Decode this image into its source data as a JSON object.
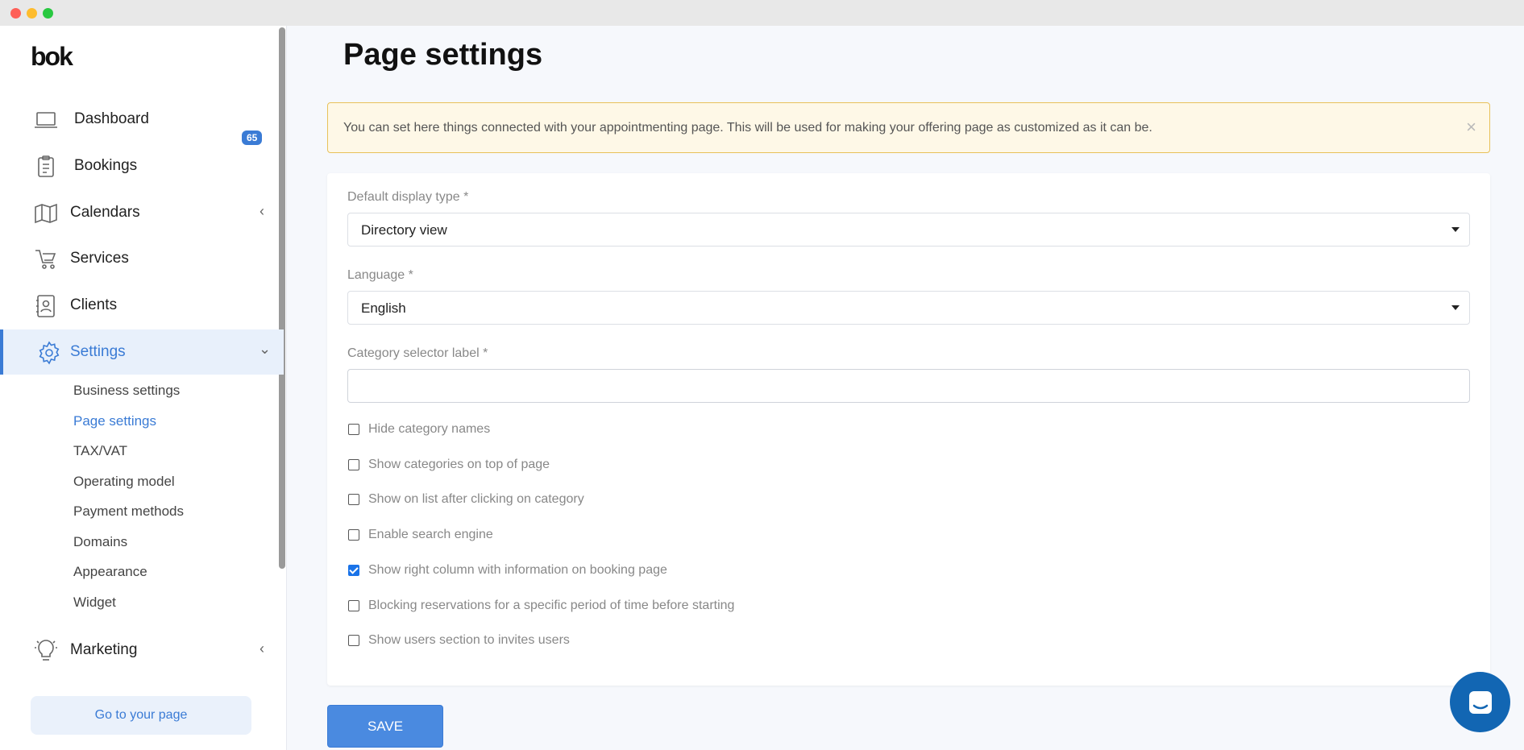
{
  "window": {
    "buttons": [
      "close",
      "minimize",
      "maximize"
    ]
  },
  "brand": {
    "logo": "bok"
  },
  "sidebar": {
    "items": [
      {
        "label": "Dashboard",
        "icon": "laptop-icon"
      },
      {
        "label": "Bookings",
        "icon": "clipboard-icon",
        "badge": "65"
      },
      {
        "label": "Calendars",
        "icon": "map-icon",
        "chevron": "‹"
      },
      {
        "label": "Services",
        "icon": "cart-icon"
      },
      {
        "label": "Clients",
        "icon": "contacts-icon"
      },
      {
        "label": "Settings",
        "icon": "gear-icon",
        "chevron": "⌄"
      },
      {
        "label": "Marketing",
        "icon": "lightbulb-icon",
        "chevron": "‹"
      }
    ],
    "settings_submenu": [
      "Business settings",
      "Page settings",
      "TAX/VAT",
      "Operating model",
      "Payment methods",
      "Domains",
      "Appearance",
      "Widget"
    ],
    "go_to_page": "Go to your page"
  },
  "main": {
    "title": "Page settings",
    "alert": {
      "text": "You can set here things connected with your appointmenting page. This will be used for making your offering page as customized as it can be.",
      "close": "×"
    },
    "form": {
      "display_type": {
        "label": "Default display type *",
        "value": "Directory view"
      },
      "language": {
        "label": "Language *",
        "value": "English"
      },
      "category_label": {
        "label": "Category selector label *",
        "value": ""
      },
      "checkboxes": [
        {
          "label": "Hide category names",
          "checked": false
        },
        {
          "label": "Show categories on top of page",
          "checked": false
        },
        {
          "label": "Show on list after clicking on category",
          "checked": false
        },
        {
          "label": "Enable search engine",
          "checked": false
        },
        {
          "label": "Show right column with information on booking page",
          "checked": true
        },
        {
          "label": "Blocking reservations for a specific period of time before starting",
          "checked": false
        },
        {
          "label": "Show users section to invites users",
          "checked": false
        }
      ]
    },
    "save_label": "SAVE"
  },
  "colors": {
    "accent": "#3a7bd5",
    "alert_bg": "#fef8e7",
    "alert_border": "#e8c15a",
    "chat": "#1266b3"
  }
}
